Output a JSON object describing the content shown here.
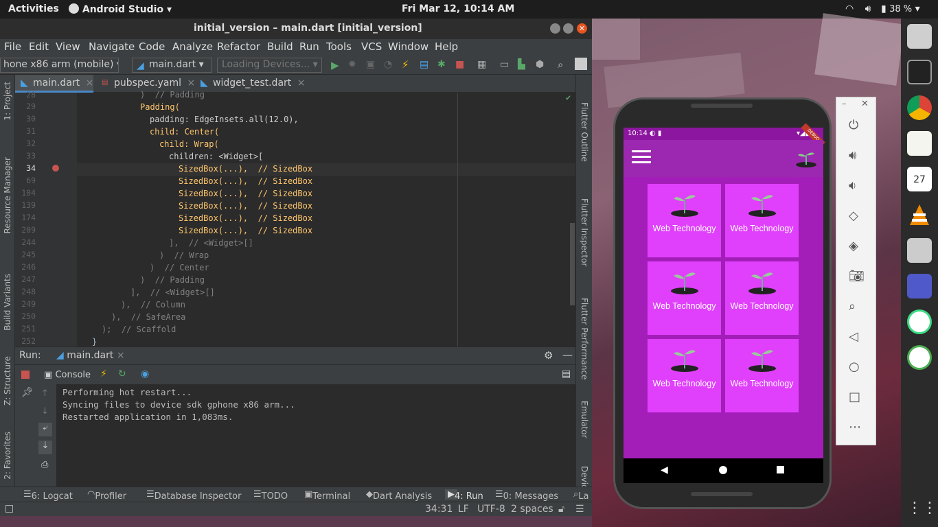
{
  "topbar": {
    "activities": "Activities",
    "app_name": "Android Studio",
    "clock": "Fri Mar 12, 10:14 AM",
    "battery": "38 %"
  },
  "window": {
    "title": "initial_version – main.dart [initial_version]"
  },
  "menu": [
    "File",
    "Edit",
    "View",
    "Navigate",
    "Code",
    "Analyze",
    "Refactor",
    "Build",
    "Run",
    "Tools",
    "VCS",
    "Window",
    "Help"
  ],
  "toolbar": {
    "device_selector": "hone x86 arm (mobile)",
    "run_config": "main.dart",
    "loading_devices": "Loading Devices..."
  },
  "tabs": [
    {
      "label": "main.dart",
      "active": true
    },
    {
      "label": "pubspec.yaml",
      "active": false
    },
    {
      "label": "widget_test.dart",
      "active": false
    }
  ],
  "left_tools": [
    "1: Project",
    "Resource Manager",
    "Build Variants",
    "Z: Structure",
    "2: Favorites"
  ],
  "right_tools": [
    "Flutter Outline",
    "Flutter Inspector",
    "Flutter Performance",
    "Emulator",
    "Device"
  ],
  "code_lines": [
    {
      "num": "28",
      "text": ")  // Padding"
    },
    {
      "num": "29",
      "text": "Padding("
    },
    {
      "num": "30",
      "text": "padding: EdgeInsets.all(12.0),"
    },
    {
      "num": "31",
      "text": "child: Center("
    },
    {
      "num": "32",
      "text": "child: Wrap("
    },
    {
      "num": "33",
      "text": "children: <Widget>["
    },
    {
      "num": "34",
      "text": "SizedBox(...),  // SizedBox"
    },
    {
      "num": "69",
      "text": "SizedBox(...),  // SizedBox"
    },
    {
      "num": "104",
      "text": "SizedBox(...),  // SizedBox"
    },
    {
      "num": "139",
      "text": "SizedBox(...),  // SizedBox"
    },
    {
      "num": "174",
      "text": "SizedBox(...),  // SizedBox"
    },
    {
      "num": "209",
      "text": "SizedBox(...),  // SizedBox"
    },
    {
      "num": "244",
      "text": "],  // <Widget>[]"
    },
    {
      "num": "245",
      "text": ")  // Wrap"
    },
    {
      "num": "246",
      "text": ")  // Center"
    },
    {
      "num": "247",
      "text": ")  // Padding"
    },
    {
      "num": "248",
      "text": "],  // <Widget>[]"
    },
    {
      "num": "249",
      "text": "),  // Column"
    },
    {
      "num": "250",
      "text": "),  // SafeArea"
    },
    {
      "num": "251",
      "text": ");  // Scaffold"
    },
    {
      "num": "252",
      "text": "}"
    }
  ],
  "run_panel": {
    "label": "Run:",
    "config": "main.dart",
    "console_tab": "Console",
    "output": [
      "Performing hot restart...",
      "Syncing files to device sdk gphone x86 arm...",
      "Restarted application in 1,083ms."
    ]
  },
  "bottom_tools": [
    "6: Logcat",
    "Profiler",
    "Database Inspector",
    "TODO",
    "Terminal",
    "Dart Analysis",
    "4: Run",
    "0: Messages",
    "La"
  ],
  "status": {
    "position": "34:31",
    "line_sep": "LF",
    "encoding": "UTF-8",
    "indent": "2 spaces"
  },
  "emulator": {
    "time": "10:14",
    "debug_banner": "DEBUG",
    "card_label": "Web Technology",
    "cards": 6
  },
  "colors": {
    "app_primary": "#9c27b0",
    "card": "#e040fb",
    "editor_bg": "#2b2b2b",
    "ide_bg": "#3c3f41"
  }
}
